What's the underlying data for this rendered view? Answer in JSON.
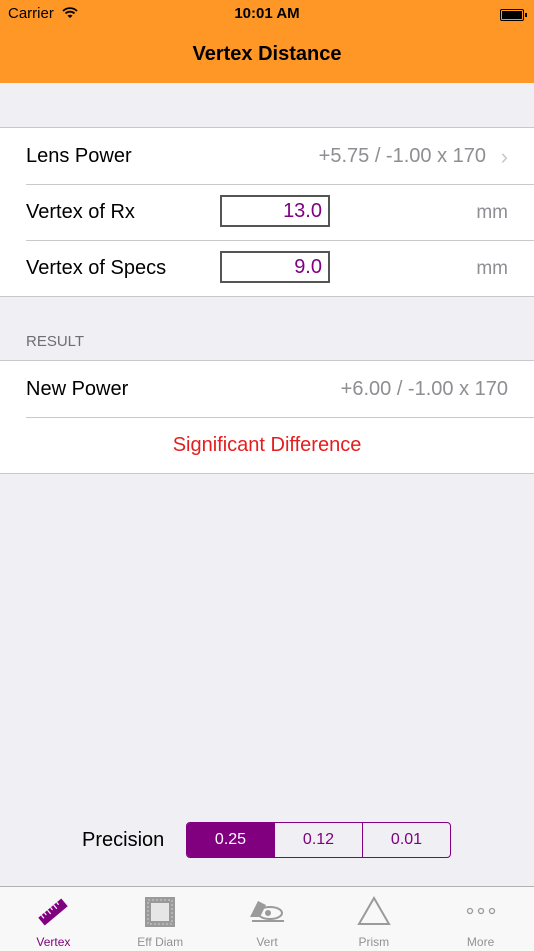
{
  "status_bar": {
    "carrier": "Carrier",
    "time": "10:01 AM",
    "wifi_icon": "wifi-icon",
    "battery_icon": "battery-icon"
  },
  "nav": {
    "title": "Vertex Distance"
  },
  "inputs": {
    "lens_power": {
      "label": "Lens Power",
      "value": "+5.75 / -1.00 x 170"
    },
    "vertex_rx": {
      "label": "Vertex of Rx",
      "value": "13.0",
      "unit": "mm"
    },
    "vertex_specs": {
      "label": "Vertex of Specs",
      "value": "9.0",
      "unit": "mm"
    }
  },
  "result": {
    "header": "RESULT",
    "new_power_label": "New Power",
    "new_power_value": "+6.00 / -1.00 x 170",
    "warning": "Significant Difference"
  },
  "precision": {
    "label": "Precision",
    "options": [
      "0.25",
      "0.12",
      "0.01"
    ],
    "selected": "0.25"
  },
  "tabs": [
    {
      "label": "Vertex",
      "icon": "ruler-icon",
      "active": true
    },
    {
      "label": "Eff Diam",
      "icon": "frame-icon",
      "active": false
    },
    {
      "label": "Vert",
      "icon": "lensmeter-icon",
      "active": false
    },
    {
      "label": "Prism",
      "icon": "triangle-icon",
      "active": false
    },
    {
      "label": "More",
      "icon": "more-icon",
      "active": false
    }
  ],
  "colors": {
    "nav_background": "#ff9726",
    "accent": "#800080",
    "warning": "#e41e1e"
  }
}
